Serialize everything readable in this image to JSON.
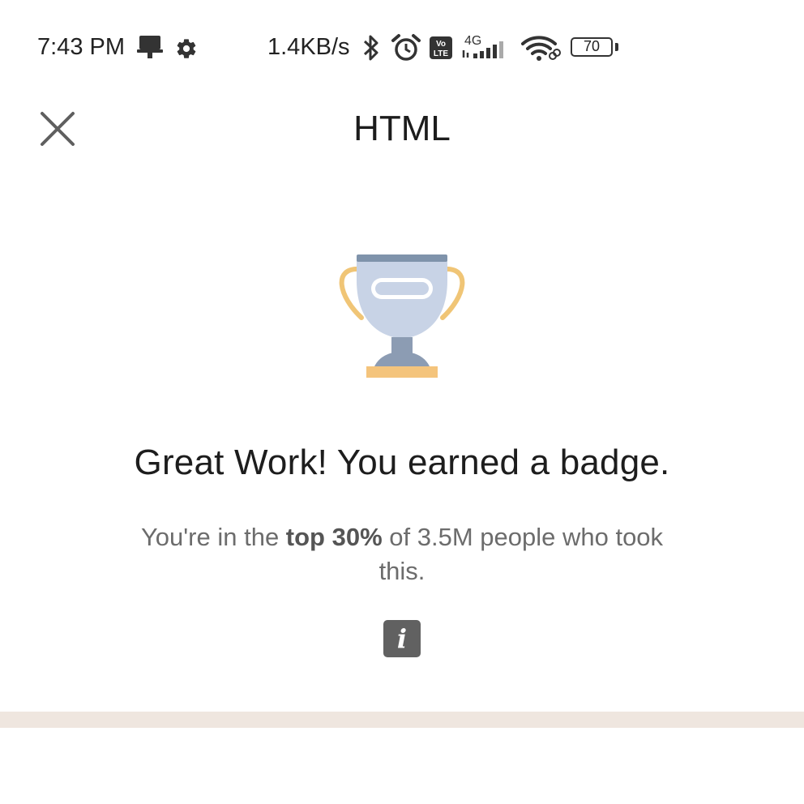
{
  "status_bar": {
    "time": "7:43 PM",
    "speed": "1.4KB/s",
    "network": "4G",
    "volte": "Vo LTE",
    "battery": "70",
    "icons": [
      "notification-icon",
      "gear-icon",
      "bluetooth-icon",
      "alarm-icon",
      "volte-icon",
      "signal-icon",
      "wifi-icon",
      "battery-icon"
    ]
  },
  "header": {
    "title": "HTML",
    "close_icon": "close-icon"
  },
  "trophy": {
    "icon": "trophy-icon",
    "colors": {
      "cup": "#c8d3e6",
      "rim": "#7f93ab",
      "stem": "#8c9cb3",
      "handles": "#f0c576",
      "base": "#f4c47c"
    }
  },
  "result": {
    "headline": "Great Work! You earned a badge.",
    "sub_pre": "You're in the ",
    "sub_bold": "top 30%",
    "sub_post": " of 3.5M people who took this."
  },
  "info": {
    "label": "i",
    "icon": "info-icon"
  },
  "colors": {
    "divider": "#efe6df",
    "info_bg": "#616161"
  }
}
